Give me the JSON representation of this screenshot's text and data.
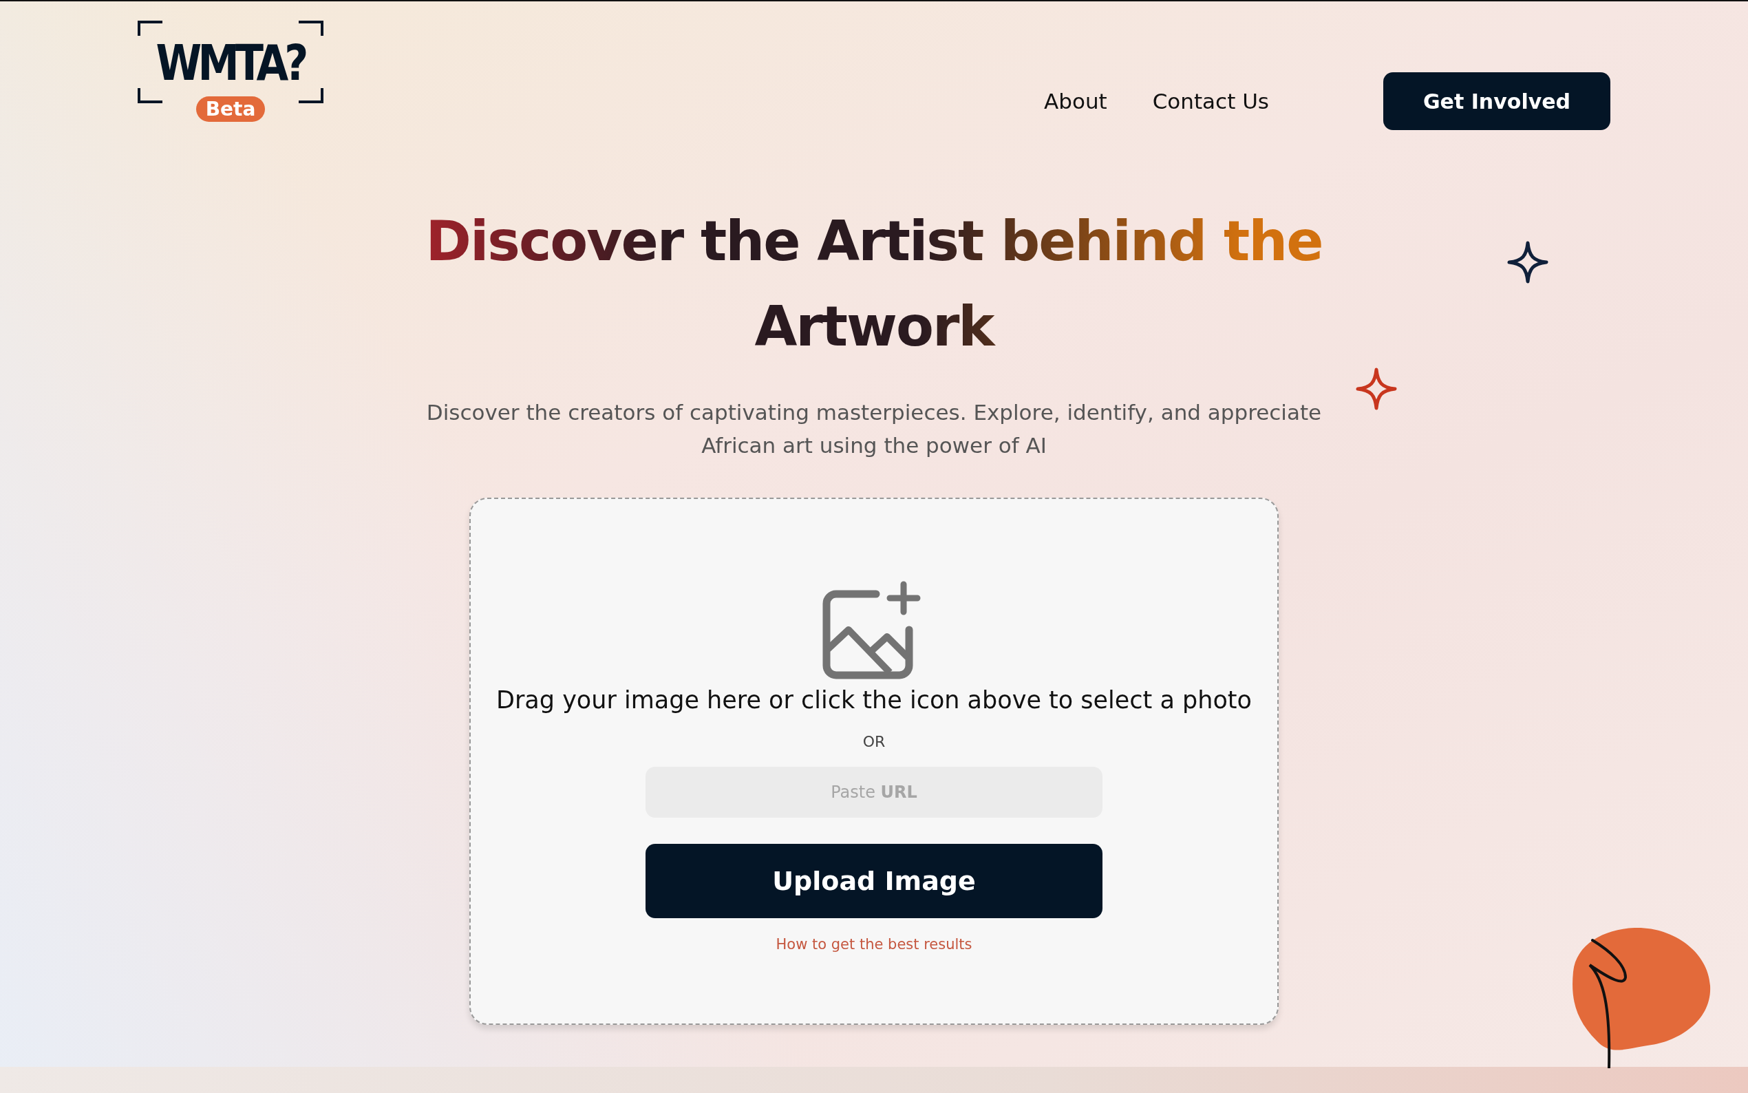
{
  "logo": {
    "text": "WMTA?",
    "badge": "Beta"
  },
  "nav": {
    "links": [
      "About",
      "Contact Us"
    ],
    "cta": "Get Involved"
  },
  "hero": {
    "title": "Discover the Artist behind the Artwork",
    "subtitle": "Discover the creators of captivating masterpieces. Explore, identify, and appreciate African art using the power of AI"
  },
  "upload": {
    "prompt": "Drag your image here or click the icon above to select a photo",
    "separator": "OR",
    "url_field": {
      "placeholder": "Paste **URL**"
    },
    "button": "Upload Image",
    "help_link": "How to get the best results"
  }
}
